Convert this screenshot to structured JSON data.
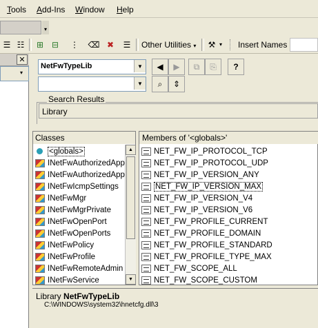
{
  "menu": {
    "items": [
      {
        "label": "Tools",
        "u": "T",
        "rest": "ools"
      },
      {
        "label": "Add-Ins",
        "u": "A",
        "rest": "dd-Ins"
      },
      {
        "label": "Window",
        "u": "W",
        "rest": "indow"
      },
      {
        "label": "Help",
        "u": "H",
        "rest": "elp"
      }
    ]
  },
  "toolbar": {
    "other_utilities": "Other Utilities",
    "insert_names": "Insert Names"
  },
  "browser": {
    "library_combo_value": "NetFwTypeLib",
    "search_combo_value": "",
    "search_results_label": "Search Results",
    "search_results_header": "Library",
    "classes_header": "Classes",
    "members_header": "Members of '<globals>'",
    "classes": [
      "<globals>",
      "INetFwAuthorizedApp",
      "INetFwAuthorizedApps",
      "INetFwIcmpSettings",
      "INetFwMgr",
      "INetFwMgrPrivate",
      "INetFwOpenPort",
      "INetFwOpenPorts",
      "INetFwPolicy",
      "INetFwProfile",
      "INetFwRemoteAdmin",
      "INetFwService"
    ],
    "members": [
      "NET_FW_IP_PROTOCOL_TCP",
      "NET_FW_IP_PROTOCOL_UDP",
      "NET_FW_IP_VERSION_ANY",
      "NET_FW_IP_VERSION_MAX",
      "NET_FW_IP_VERSION_V4",
      "NET_FW_IP_VERSION_V6",
      "NET_FW_PROFILE_CURRENT",
      "NET_FW_PROFILE_DOMAIN",
      "NET_FW_PROFILE_STANDARD",
      "NET_FW_PROFILE_TYPE_MAX",
      "NET_FW_SCOPE_ALL",
      "NET_FW_SCOPE_CUSTOM"
    ],
    "details": {
      "prefix": "Library",
      "name": "NetFwTypeLib",
      "path": "C:\\WINDOWS\\system32\\hnetcfg.dll\\3"
    }
  }
}
